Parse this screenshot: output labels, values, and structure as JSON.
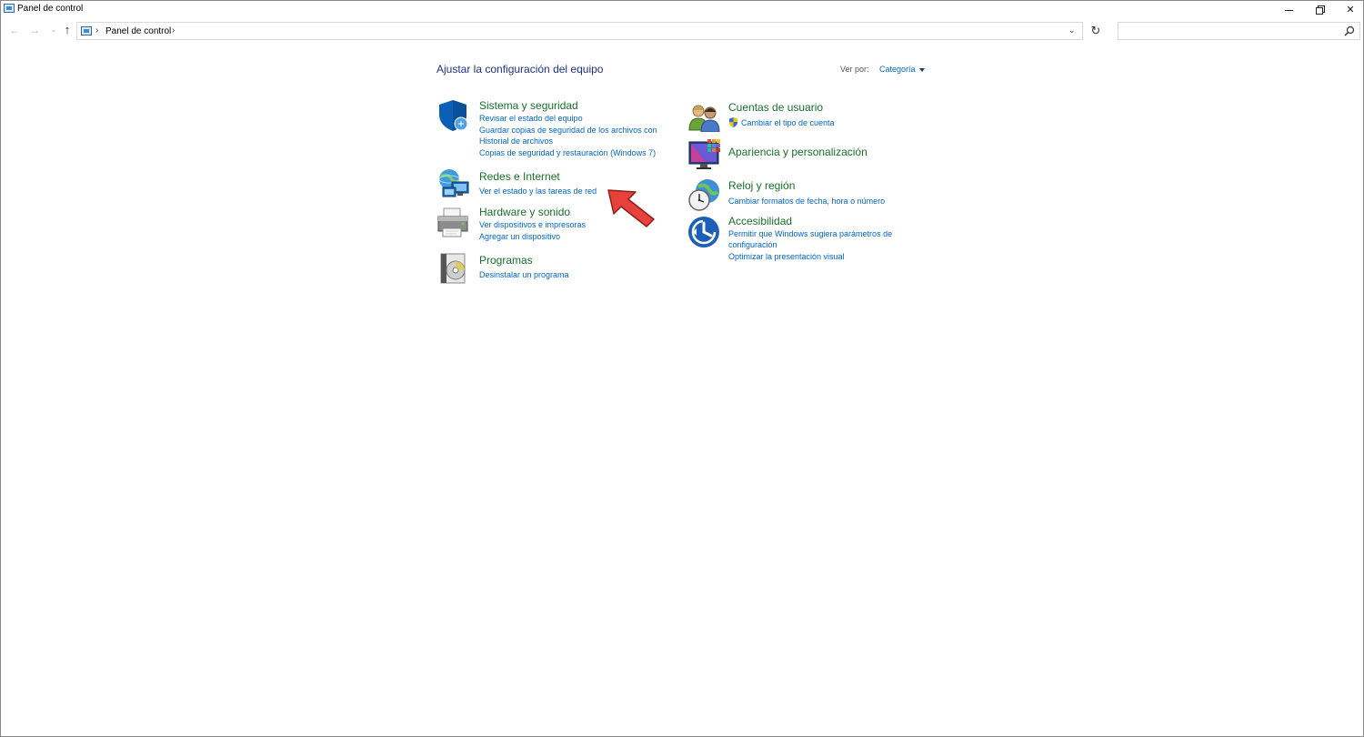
{
  "window": {
    "title": "Panel de control",
    "minimize_icon": "minimize-icon",
    "maximize_icon": "restore-icon",
    "close_glyph": "✕"
  },
  "nav": {
    "back_glyph": "←",
    "forward_glyph": "→",
    "recent_glyph": "⌄",
    "up_glyph": "↑",
    "breadcrumb": "Panel de control",
    "separator": "›",
    "dropdown_glyph": "⌄",
    "refresh_glyph": "↻",
    "search_placeholder": ""
  },
  "main": {
    "heading": "Ajustar la configuración del equipo",
    "view_by_label": "Ver por:",
    "view_by_value": "Categoría"
  },
  "categories": {
    "system": {
      "icon": "shield-icon",
      "title": "Sistema y seguridad",
      "links": [
        "Revisar el estado del equipo",
        "Guardar copias de seguridad de los archivos con",
        "Historial de archivos",
        "Copias de seguridad y restauración (Windows 7)"
      ]
    },
    "network": {
      "icon": "network-globe-icon",
      "title": "Redes e Internet",
      "links": [
        "Ver el estado y las tareas de red"
      ]
    },
    "hardware": {
      "icon": "printer-icon",
      "title": "Hardware y sonido",
      "links": [
        "Ver dispositivos e impresoras",
        "Agregar un dispositivo"
      ]
    },
    "programs": {
      "icon": "programs-disc-icon",
      "title": "Programas",
      "links": [
        "Desinstalar un programa"
      ]
    },
    "users": {
      "icon": "users-icon",
      "title": "Cuentas de usuario",
      "links": [
        "Cambiar el tipo de cuenta"
      ]
    },
    "appearance": {
      "icon": "monitor-palette-icon",
      "title": "Apariencia y personalización",
      "links": []
    },
    "clock": {
      "icon": "clock-globe-icon",
      "title": "Reloj y región",
      "links": [
        "Cambiar formatos de fecha, hora o número"
      ]
    },
    "access": {
      "icon": "accessibility-icon",
      "title": "Accesibilidad",
      "links": [
        "Permitir que Windows sugiera parámetros de",
        "configuración",
        "Optimizar la presentación visual"
      ]
    }
  },
  "colors": {
    "title_green": "#17702a",
    "link_blue": "#0066cc",
    "heading_blue": "#1e3287",
    "annotation_red": "#e8413b"
  }
}
